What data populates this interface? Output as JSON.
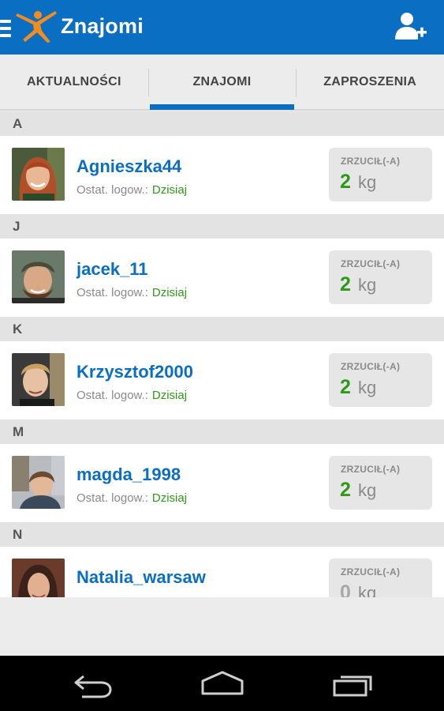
{
  "app": {
    "title": "Znajomi",
    "brand_color": "#0a6fc2",
    "logo_color": "#f28c1e"
  },
  "tabs": [
    {
      "label": "AKTUALNOŚCI",
      "active": false
    },
    {
      "label": "ZNAJOMI",
      "active": true
    },
    {
      "label": "ZAPROSZENIA",
      "active": false
    }
  ],
  "friends": [
    {
      "section": "A",
      "name": "Agnieszka44",
      "last_login_label": "Ostat. logow.:",
      "last_login": "Dzisiaj",
      "lost_label": "ZRZUCIŁ(-A)",
      "lost_value": "2",
      "lost_unit": "kg"
    },
    {
      "section": "J",
      "name": "jacek_11",
      "last_login_label": "Ostat. logow.:",
      "last_login": "Dzisiaj",
      "lost_label": "ZRZUCIŁ(-A)",
      "lost_value": "2",
      "lost_unit": "kg"
    },
    {
      "section": "K",
      "name": "Krzysztof2000",
      "last_login_label": "Ostat. logow.:",
      "last_login": "Dzisiaj",
      "lost_label": "ZRZUCIŁ(-A)",
      "lost_value": "2",
      "lost_unit": "kg"
    },
    {
      "section": "M",
      "name": "magda_1998",
      "last_login_label": "Ostat. logow.:",
      "last_login": "Dzisiaj",
      "lost_label": "ZRZUCIŁ(-A)",
      "lost_value": "2",
      "lost_unit": "kg"
    },
    {
      "section": "N",
      "name": "Natalia_warsaw",
      "last_login_label": "",
      "last_login": "",
      "lost_label": "ZRZUCIŁ(-A)",
      "lost_value": "0",
      "lost_unit": "kg"
    }
  ],
  "icons": {
    "menu": "hamburger-icon",
    "logo": "running-person-logo",
    "add_friend": "add-person-icon",
    "nav_back": "back-icon",
    "nav_home": "home-icon",
    "nav_recents": "recents-icon"
  },
  "colors": {
    "accent_green": "#2e9a18",
    "link_blue": "#0a6fc2"
  }
}
